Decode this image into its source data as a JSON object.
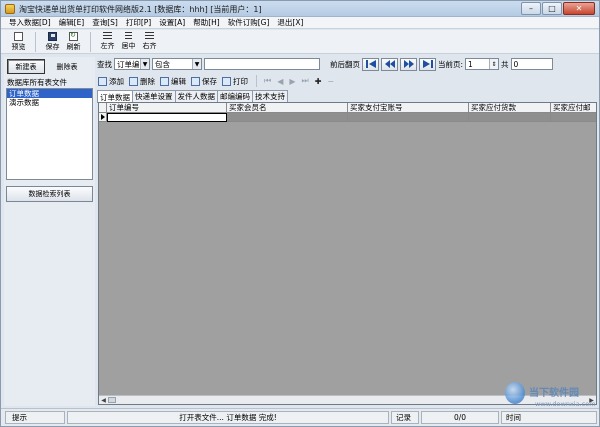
{
  "window": {
    "title": "淘宝快递单出货单打印软件网络版2.1 [数据库：hhh] [当前用户：1]",
    "buttons": [
      "–",
      "□",
      "✕"
    ]
  },
  "menu": [
    "导入数据[D]",
    "编辑[E]",
    "查询[S]",
    "打印[P]",
    "设置[A]",
    "帮助[H]",
    "软件订购[G]",
    "退出[X]"
  ],
  "toolbar": {
    "preview": "预览",
    "save": "保存",
    "refresh": "刷新",
    "align_left": "左齐",
    "align_center": "居中",
    "align_right": "右齐"
  },
  "left": {
    "new_table": "新建表",
    "delete_table": "删除表",
    "list_label": "数据库所有表文件",
    "tables": [
      "订单数据",
      "演示数据"
    ],
    "selected_index": 0,
    "search_list_button": "数据检索列表"
  },
  "search": {
    "label": "查找",
    "field": "订单编号",
    "match": "包含",
    "keyword": "",
    "page_label": "前后翻页",
    "current_page_label": "当前页:",
    "current_page": "1",
    "total_label": "共",
    "total": "0"
  },
  "actions": {
    "add": "添加",
    "delete": "删除",
    "edit": "编辑",
    "save": "保存",
    "print": "打印"
  },
  "tabs": [
    "订单数据",
    "快递单设置",
    "发件人数据",
    "邮编编码",
    "技术支持"
  ],
  "active_tab": 0,
  "grid": {
    "columns": [
      "订单编号",
      "买家会员名",
      "买家支付宝账号",
      "买家应付货款",
      "买家应付邮"
    ]
  },
  "status": {
    "hint_label": "提示",
    "message": "打开表文件... 订单数据 完成!",
    "record_label": "记录",
    "record_value": "0/0",
    "time_label": "时间"
  },
  "watermark": {
    "text": "当下软件园",
    "sub": "www.downxia.com"
  }
}
